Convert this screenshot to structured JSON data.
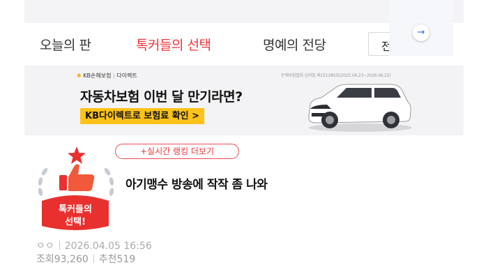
{
  "nav": {
    "tabs": [
      {
        "label": "오늘의 판",
        "active": false
      },
      {
        "label": "톡커들의 선택",
        "active": true
      },
      {
        "label": "명예의 전당",
        "active": false
      }
    ],
    "search_partial_text": "전",
    "arrow_glyph": "→",
    "active_color": "#f0363b"
  },
  "ad": {
    "brand": "KB손해보험",
    "sub_brand": "다이렉트",
    "notice": "손해보험협회 심의필 제151285호(2025.06.23~2026.06.22)",
    "headline": "자동차보험 이번 달 만기라면?",
    "cta": "KB다이렉트로 보험료 확인 >",
    "cta_color": "#ffc21a"
  },
  "post": {
    "ranking_button": "+실시간 랭킹 더보기",
    "badge_text_line1": "톡커들의",
    "badge_text_line2": "선택!",
    "title": "아기맹수 방송에 작작 좀 나와",
    "author": "ㅇㅇ",
    "date": "2026.04.05 16:56",
    "views_label": "조회",
    "views": "93,260",
    "recommend_label": "추천",
    "recommend": "519"
  }
}
